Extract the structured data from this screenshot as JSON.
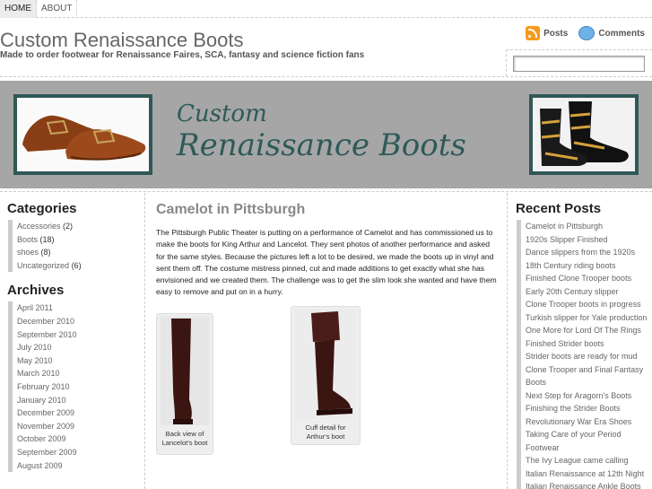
{
  "nav": {
    "items": [
      {
        "label": "HOME"
      },
      {
        "label": "ABOUT"
      }
    ]
  },
  "header": {
    "title": "Custom Renaissance Boots",
    "tagline": "Made to order footwear for Renaissance Faires, SCA, fantasy and science fiction fans",
    "feeds": {
      "posts_label": "Posts",
      "comments_label": "Comments"
    },
    "search": {
      "value": ""
    }
  },
  "banner": {
    "line1": "Custom",
    "line2": "Renaissance Boots"
  },
  "categories": {
    "title": "Categories",
    "items": [
      {
        "label": "Accessories",
        "count": "(2)"
      },
      {
        "label": "Boots",
        "count": "(18)"
      },
      {
        "label": "shoes",
        "count": "(8)"
      },
      {
        "label": "Uncategorized",
        "count": "(6)"
      }
    ]
  },
  "archives": {
    "title": "Archives",
    "items": [
      "April 2011",
      "December 2010",
      "September 2010",
      "July 2010",
      "May 2010",
      "March 2010",
      "February 2010",
      "January 2010",
      "December 2009",
      "November 2009",
      "October 2009",
      "September 2009",
      "August 2009"
    ]
  },
  "post": {
    "title": "Camelot in Pittsburgh",
    "body": "The Pittsburgh Public Theater is putting on a performance of Camelot and has commissioned us to make the boots for King Arthur and Lancelot. They sent photos of another performance and asked for the same styles. Because the pictures left a lot to be desired, we made the boots up in vinyl and sent them off. The costume mistress pinned, cut and made additions to get exactly what she has envisioned and we created them. The challenge was to get the slim look she wanted and have them easy to remove and put on in a hurry.",
    "images": [
      {
        "caption": "Back view of Lancelot's boot"
      },
      {
        "caption": "Cuff detail for Arthur's boot"
      }
    ]
  },
  "recent_posts": {
    "title": "Recent Posts",
    "items": [
      "Camelot in Pittsburgh",
      "1920s Slipper Finished",
      "Dance slippers from the 1920s",
      "18th Century riding boots",
      "Finished Clone Trooper boots",
      "Early 20th Century slipper",
      "Clone Trooper boots in progress",
      "Turkish slipper for Yale production",
      "One More for Lord Of The Rings",
      "Finished Strider boots",
      "Strider boots are ready for mud",
      "Clone Trooper and Final Fantasy Boots",
      "Next Step for Aragorn's Boots",
      "Finishing the Strider Boots",
      "Revolutionary War Era Shoes",
      "Taking Care of your Period Footwear",
      "The Ivy League came calling",
      "Italian Renaissance at 12th Night",
      "Italian Renaissance Ankle Boots"
    ]
  },
  "colors": {
    "banner_bg": "#a6a6a6",
    "banner_text": "#2e5a58",
    "frame": "#2f5856"
  }
}
